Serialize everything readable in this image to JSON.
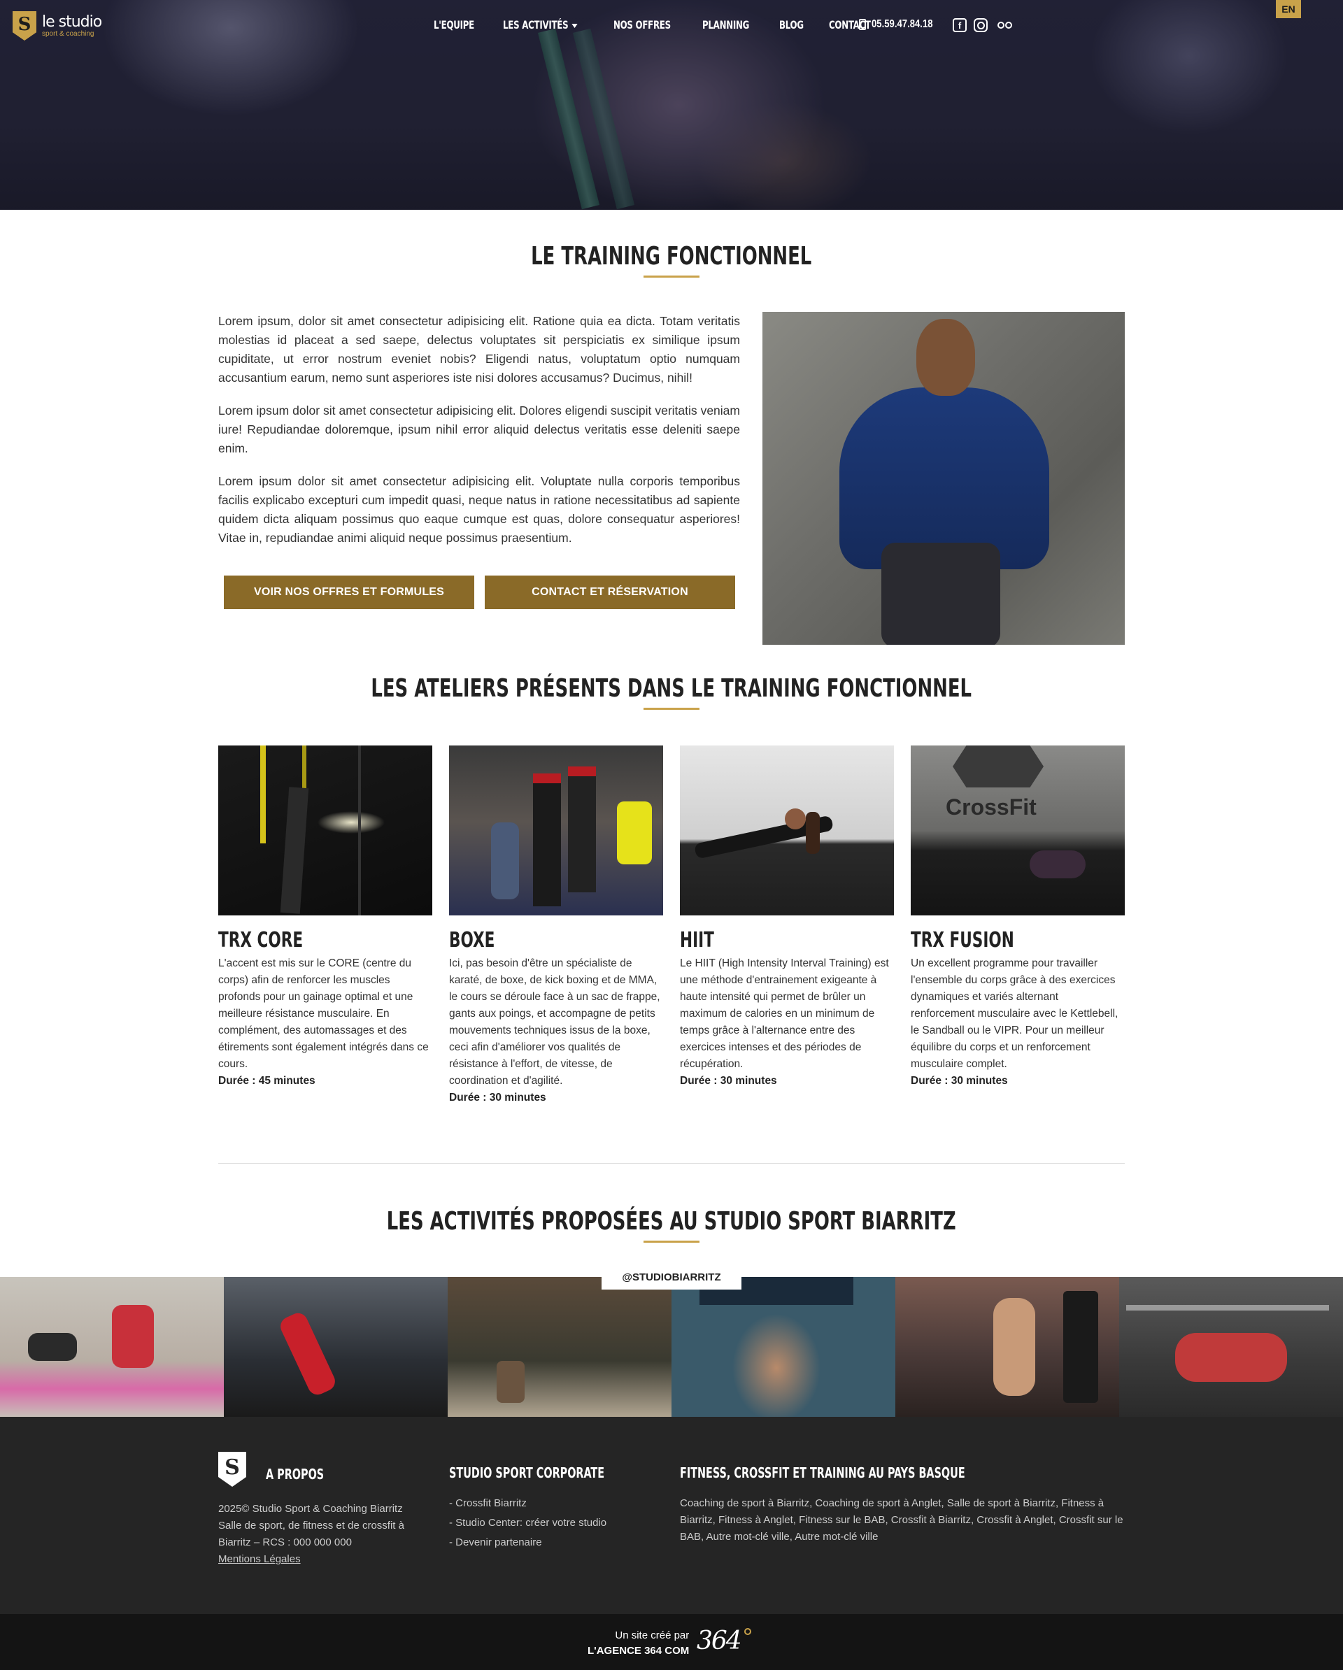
{
  "header": {
    "logo_main": "le studio",
    "logo_sub": "sport & coaching",
    "nav": [
      {
        "label": "L'EQUIPE"
      },
      {
        "label": "LES ACTIVITÉS"
      },
      {
        "label": "NOS OFFRES"
      },
      {
        "label": "PLANNING"
      },
      {
        "label": "BLOG"
      },
      {
        "label": "CONTACT"
      }
    ],
    "phone": "05.59.47.84.18",
    "lang": "EN"
  },
  "intro": {
    "title": "LE TRAINING FONCTIONNEL",
    "paragraphs": [
      "Lorem ipsum, dolor sit amet consectetur adipisicing elit. Ratione quia ea dicta. Totam veritatis molestias id placeat a sed saepe, delectus voluptates sit perspiciatis ex similique ipsum cupiditate, ut error nostrum eveniet nobis? Eligendi natus, voluptatum optio numquam accusantium earum, nemo sunt asperiores iste nisi dolores accusamus? Ducimus, nihil!",
      "Lorem ipsum dolor sit amet consectetur adipisicing elit. Dolores eligendi suscipit veritatis veniam iure! Repudiandae doloremque, ipsum nihil error aliquid delectus veritatis esse deleniti saepe enim.",
      "Lorem ipsum dolor sit amet consectetur adipisicing elit. Voluptate nulla corporis temporibus facilis explicabo excepturi cum impedit quasi, neque natus in ratione necessitatibus ad sapiente quidem dicta aliquam possimus quo eaque cumque est quas, dolore consequatur asperiores! Vitae in, repudiandae animi aliquid neque possimus praesentium."
    ],
    "btn_offres": "VOIR NOS OFFRES ET FORMULES",
    "btn_contact": "CONTACT ET RÉSERVATION"
  },
  "ateliers": {
    "title": "LES ATELIERS PRÉSENTS DANS LE TRAINING FONCTIONNEL",
    "items": [
      {
        "name": "TRX CORE",
        "desc": "L'accent est mis sur le CORE (centre du corps) afin de renforcer les muscles profonds pour un gainage optimal et une meilleure résistance musculaire. En complément, des automassages et des étirements sont également intégrés dans ce cours.",
        "duration": "Durée : 45 minutes"
      },
      {
        "name": "BOXE",
        "desc": "Ici, pas besoin d'être un spécialiste de karaté, de boxe, de kick boxing et de MMA, le cours se déroule face à un sac de frappe, gants aux poings, et accompagne de petits mouvements techniques issus de la boxe, ceci afin d'améliorer vos qualités de résistance à l'effort, de vitesse, de coordination et d'agilité.",
        "duration": "Durée : 30 minutes"
      },
      {
        "name": "HIIT",
        "desc": "Le HIIT (High Intensity Interval Training) est une méthode d'entrainement exigeante à haute intensité qui permet de brûler un maximum de calories en un minimum de temps grâce à l'alternance entre des exercices intenses et des périodes de récupération.",
        "duration": "Durée : 30 minutes"
      },
      {
        "name": "TRX FUSION",
        "desc": "Un excellent programme pour travailler l'ensemble du corps grâce à des exercices dynamiques et variés alternant renforcement musculaire avec le Kettlebell, le Sandball ou le VIPR. Pour un meilleur équilibre du corps et un renforcement musculaire complet.",
        "duration": "Durée : 30 minutes"
      }
    ]
  },
  "activites": {
    "title": "LES ACTIVITÉS PROPOSÉES AU STUDIO SPORT BIARRITZ",
    "insta_tag": "@STUDIOBIARRITZ"
  },
  "footer": {
    "about_title": "A PROPOS",
    "about_lines": [
      "2025© Studio Sport & Coaching Biarritz",
      "Salle de sport, de fitness et de crossfit à",
      "Biarritz – RCS : 000 000 000"
    ],
    "mentions": "Mentions Légales",
    "corporate_title": "STUDIO SPORT CORPORATE",
    "corporate_links": [
      "- Crossfit Biarritz",
      "- Studio Center: créer votre studio",
      "- Devenir partenaire"
    ],
    "basque_title": "FITNESS, CROSSFIT ET TRAINING AU PAYS BASQUE",
    "basque_text": "Coaching de sport à Biarritz, Coaching de sport à Anglet, Salle de sport à Biarritz, Fitness à Biarritz, Fitness à Anglet, Fitness sur le BAB, Crossfit à Biarritz, Crossfit à Anglet, Crossfit sur le BAB, Autre mot-clé ville, Autre mot-clé ville",
    "credit_line1": "Un site créé par",
    "credit_line2": "L'AGENCE 364 COM",
    "agency_logo": "364"
  },
  "colors": {
    "accent": "#c9a24a",
    "button": "#8a6a28",
    "footer_bg": "#252525"
  }
}
